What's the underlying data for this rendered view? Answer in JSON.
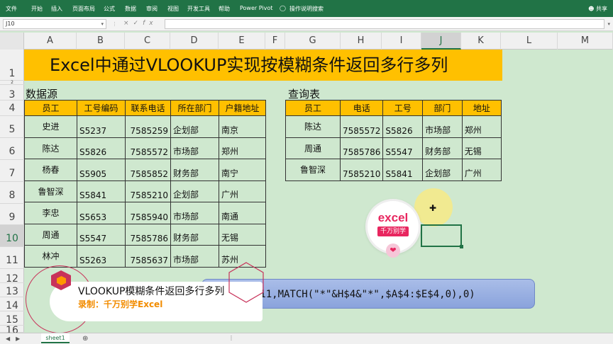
{
  "ribbon": {
    "tabs": [
      "文件",
      "开始",
      "插入",
      "页面布局",
      "公式",
      "数据",
      "审阅",
      "视图",
      "开发工具",
      "帮助",
      "Power Pivot"
    ],
    "search": "操作说明搜索",
    "share": "共享"
  },
  "formula_bar": {
    "name_box": "J10",
    "cancel": "×",
    "enter": "✓",
    "fx": "fx"
  },
  "columns": [
    "A",
    "B",
    "C",
    "D",
    "E",
    "F",
    "G",
    "H",
    "I",
    "J",
    "K",
    "L",
    "M"
  ],
  "selected_column": "J",
  "rows": [
    "1",
    "2",
    "3",
    "4",
    "5",
    "6",
    "7",
    "8",
    "9",
    "10",
    "11",
    "12",
    "13",
    "14",
    "15",
    "16"
  ],
  "selected_row": "10",
  "title": "Excel中通过VLOOKUP实现按模糊条件返回多行多列",
  "source_label": "数据源",
  "query_label": "查询表",
  "source_table": {
    "headers": [
      "员工",
      "工号编码",
      "联系电话",
      "所在部门",
      "户籍地址"
    ],
    "rows": [
      [
        "史进",
        "S5237",
        "7585259",
        "企划部",
        "南京"
      ],
      [
        "陈达",
        "S5826",
        "7585572",
        "市场部",
        "郑州"
      ],
      [
        "杨春",
        "S5905",
        "7585852",
        "财务部",
        "南宁"
      ],
      [
        "鲁智深",
        "S5841",
        "7585210",
        "企划部",
        "广州"
      ],
      [
        "李忠",
        "S5653",
        "7585940",
        "市场部",
        "南通"
      ],
      [
        "周通",
        "S5547",
        "7585786",
        "财务部",
        "无锡"
      ],
      [
        "林冲",
        "S5263",
        "7585637",
        "市场部",
        "苏州"
      ]
    ]
  },
  "query_table": {
    "headers": [
      "员工",
      "电话",
      "工号",
      "部门",
      "地址"
    ],
    "rows": [
      [
        "陈达",
        "7585572",
        "S5826",
        "市场部",
        "郑州"
      ],
      [
        "周通",
        "7585786",
        "S5547",
        "财务部",
        "无锡"
      ],
      [
        "鲁智深",
        "7585210",
        "S5841",
        "企划部",
        "广州"
      ]
    ]
  },
  "formula_banner": "$E$11,MATCH(\"*\"&H$4&\"*\",$A$4:$E$4,0),0)",
  "caption": {
    "title": "VLOOKUP模糊条件返回多行多列",
    "subtitle": "录制：千万别学Excel"
  },
  "logo": {
    "word": "excel",
    "sub": "千万别学",
    "heart": "❤"
  },
  "sheet_tab": "sheet1"
}
